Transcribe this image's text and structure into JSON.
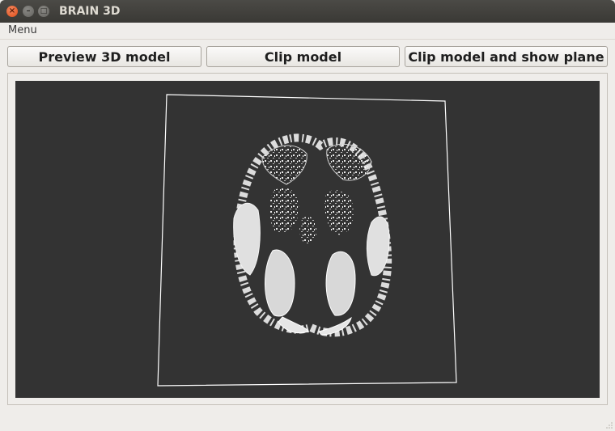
{
  "window": {
    "title": "BRAIN 3D",
    "controls": {
      "close": "×",
      "minimize": "–",
      "maximize": "□"
    }
  },
  "menubar": {
    "items": [
      {
        "label": "Menu"
      }
    ]
  },
  "toolbar": {
    "preview_label": "Preview 3D model",
    "clip_label": "Clip model",
    "clip_show_plane_label": "Clip model and show plane"
  },
  "viewport": {
    "background_color": "#333333",
    "plane_color": "#ffffff",
    "model_color": "#e6e6e6",
    "content": "brain-axial-slice-render"
  }
}
